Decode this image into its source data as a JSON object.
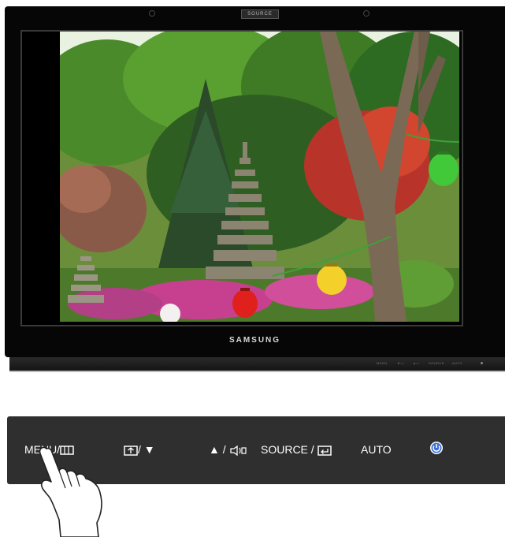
{
  "monitor": {
    "brand": "SAMSUNG",
    "top_label": "SOURCE",
    "bottom_labels": [
      "MENU",
      "▼/☼",
      "▲/♪",
      "SOURCE",
      "AUTO"
    ]
  },
  "controls": {
    "menu_label": "MENU/",
    "brightness_label": "/ ▼",
    "adjust_label": "▲ / ",
    "source_label": "SOURCE / ",
    "auto_label": "AUTO"
  },
  "icons": {
    "menu": "menu-icon",
    "brightness": "brightness-icon",
    "volume": "volume-icon",
    "enter": "enter-icon",
    "power": "power-icon",
    "hand": "pointing-hand-icon"
  },
  "colors": {
    "panel": "#2f2f2f",
    "power_blue": "#3a6fd8",
    "lantern_green": "#42c93a",
    "lantern_red": "#e0201c",
    "lantern_yellow": "#f3d02a"
  }
}
